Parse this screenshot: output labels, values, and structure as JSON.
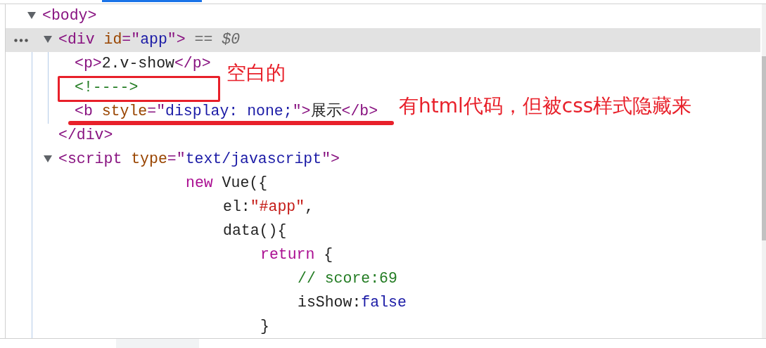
{
  "tree": [
    {
      "kind": "tag",
      "expanded": true,
      "selected": false,
      "tokens": [
        {
          "kind": "tag",
          "text": "<body>"
        }
      ],
      "children": [
        {
          "kind": "tag",
          "expanded": true,
          "selected": true,
          "tokens": [
            {
              "kind": "tag",
              "text": "<div "
            },
            {
              "kind": "attr",
              "text": "id"
            },
            {
              "kind": "tag",
              "text": "=\""
            },
            {
              "kind": "value",
              "text": "app"
            },
            {
              "kind": "tag",
              "text": "\">"
            },
            {
              "kind": "marker",
              "text": " == $0"
            }
          ],
          "children": [
            {
              "kind": "tag",
              "selected": false,
              "tokens": [
                {
                  "kind": "tag",
                  "text": "<p>"
                },
                {
                  "kind": "text",
                  "text": "2.v-show"
                },
                {
                  "kind": "tag",
                  "text": "</p>"
                }
              ]
            },
            {
              "kind": "tag",
              "selected": false,
              "tokens": [
                {
                  "kind": "comment",
                  "text": "<!---->"
                }
              ]
            },
            {
              "kind": "tag",
              "selected": false,
              "tokens": [
                {
                  "kind": "tag",
                  "text": "<b "
                },
                {
                  "kind": "attr",
                  "text": "style"
                },
                {
                  "kind": "tag",
                  "text": "=\""
                },
                {
                  "kind": "value",
                  "text": "display: none;"
                },
                {
                  "kind": "tag",
                  "text": "\">"
                },
                {
                  "kind": "text",
                  "text": "展示"
                },
                {
                  "kind": "tag",
                  "text": "</b>"
                }
              ]
            }
          ],
          "closing": [
            {
              "kind": "tag",
              "text": "</div>"
            }
          ]
        },
        {
          "kind": "tag",
          "expanded": true,
          "selected": false,
          "tokens": [
            {
              "kind": "tag",
              "text": "<script "
            },
            {
              "kind": "attr",
              "text": "type"
            },
            {
              "kind": "tag",
              "text": "=\""
            },
            {
              "kind": "value",
              "text": "text/javascript"
            },
            {
              "kind": "tag",
              "text": "\">"
            }
          ],
          "children": [
            {
              "kind": "code",
              "tokens": [
                {
                  "kind": "keyword",
                  "text": "new"
                },
                {
                  "kind": "text",
                  "text": " Vue({"
                }
              ],
              "children": [
                {
                  "kind": "code",
                  "tokens": [
                    {
                      "kind": "text",
                      "text": "el:"
                    },
                    {
                      "kind": "string",
                      "text": "\"#app\""
                    },
                    {
                      "kind": "text",
                      "text": ","
                    }
                  ]
                },
                {
                  "kind": "code",
                  "tokens": [
                    {
                      "kind": "text",
                      "text": "data(){"
                    }
                  ],
                  "children": [
                    {
                      "kind": "code",
                      "tokens": [
                        {
                          "kind": "keyword",
                          "text": "return"
                        },
                        {
                          "kind": "text",
                          "text": " {"
                        }
                      ],
                      "children": [
                        {
                          "kind": "code",
                          "tokens": [
                            {
                              "kind": "comment",
                              "text": "// score:69"
                            }
                          ]
                        },
                        {
                          "kind": "code",
                          "tokens": [
                            {
                              "kind": "text",
                              "text": "isShow:"
                            },
                            {
                              "kind": "value",
                              "text": "false"
                            }
                          ]
                        }
                      ],
                      "closing": [
                        {
                          "kind": "text",
                          "text": "}"
                        }
                      ]
                    }
                  ]
                }
              ]
            }
          ]
        }
      ]
    }
  ],
  "annotations": [
    {
      "kind": "box",
      "label": "空白的"
    },
    {
      "kind": "underline",
      "label": "有html代码，但被css样式隐藏来"
    }
  ]
}
